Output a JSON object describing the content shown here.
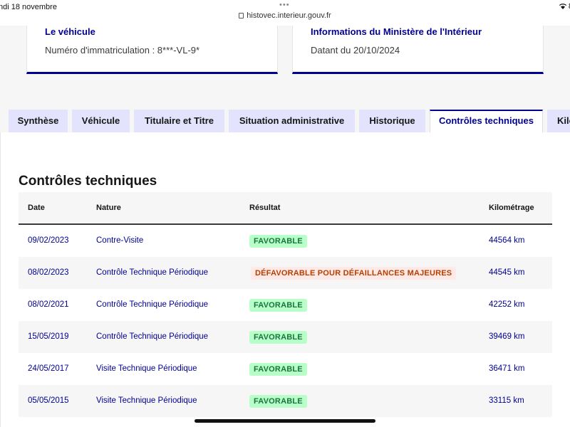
{
  "statusbar": {
    "date": "ndi 18 novembre",
    "url": "histovec.interieur.gouv.fr",
    "right": "8"
  },
  "cards": [
    {
      "title": "Le véhicule",
      "text": "Numéro d'immatriculation : 8***-VL-9*"
    },
    {
      "title": "Informations du Ministère de l'Intérieur",
      "text": "Datant du 20/10/2024"
    }
  ],
  "tabs": [
    {
      "label": "Synthèse",
      "active": false
    },
    {
      "label": "Véhicule",
      "active": false
    },
    {
      "label": "Titulaire et Titre",
      "active": false
    },
    {
      "label": "Situation administrative",
      "active": false
    },
    {
      "label": "Historique",
      "active": false
    },
    {
      "label": "Contrôles techniques",
      "active": true
    },
    {
      "label": "Kilo",
      "active": false
    }
  ],
  "section": {
    "title": "Contrôles techniques"
  },
  "table": {
    "headers": {
      "date": "Date",
      "nature": "Nature",
      "result": "Résultat",
      "km": "Kilométrage"
    },
    "rows": [
      {
        "date": "09/02/2023",
        "nature": "Contre-Visite",
        "result": "FAVORABLE",
        "status": "ok",
        "km": "44564 km"
      },
      {
        "date": "08/02/2023",
        "nature": "Contrôle Technique Périodique",
        "result": "DÉFAVORABLE POUR DÉFAILLANCES MAJEURES",
        "status": "ko",
        "km": "44545 km"
      },
      {
        "date": "08/02/2021",
        "nature": "Contrôle Technique Périodique",
        "result": "FAVORABLE",
        "status": "ok",
        "km": "42252 km"
      },
      {
        "date": "15/05/2019",
        "nature": "Contrôle Technique Périodique",
        "result": "FAVORABLE",
        "status": "ok",
        "km": "39469 km"
      },
      {
        "date": "24/05/2017",
        "nature": "Visite Technique Périodique",
        "result": "FAVORABLE",
        "status": "ok",
        "km": "36471 km"
      },
      {
        "date": "05/05/2015",
        "nature": "Visite Technique Périodique",
        "result": "FAVORABLE",
        "status": "ok",
        "km": "33115 km"
      }
    ]
  },
  "colors": {
    "primary": "#000091",
    "tab_bg": "#e3e3fd",
    "ok_bg": "#b8fec9",
    "ok_text": "#18753c",
    "ko_bg": "#ffe9e6",
    "ko_text": "#b34000"
  }
}
